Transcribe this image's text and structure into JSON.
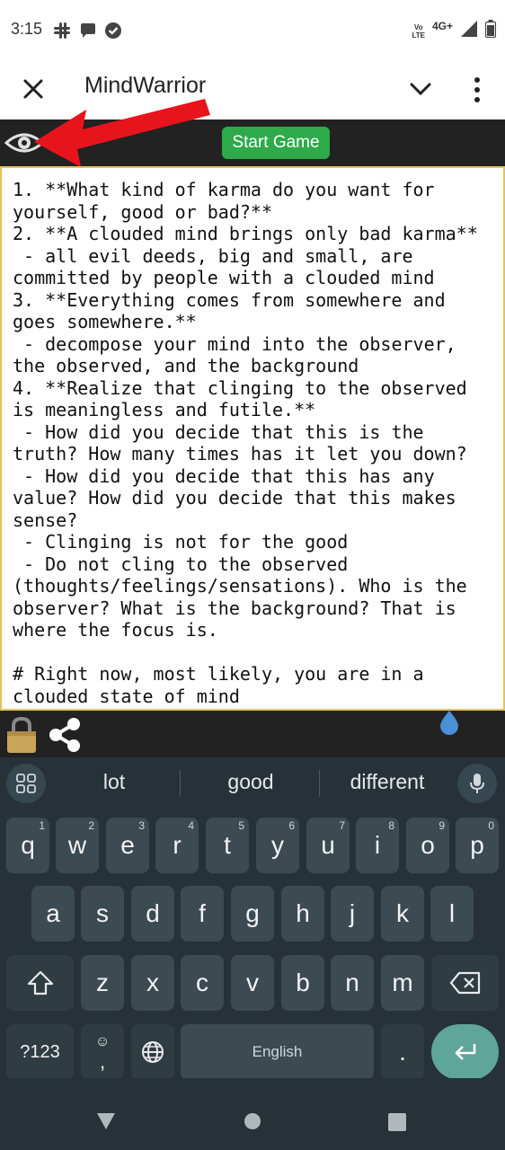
{
  "status": {
    "time": "3:15",
    "volte_line1": "Vo",
    "volte_line2": "LTE",
    "network": "4G+"
  },
  "app_bar": {
    "title": "MindWarrior"
  },
  "toolbar": {
    "start_label": "Start Game"
  },
  "editor": {
    "content": "1. **What kind of karma do you want for yourself, good or bad?**\n2. **A clouded mind brings only bad karma**\n - all evil deeds, big and small, are committed by people with a clouded mind\n3. **Everything comes from somewhere and goes somewhere.**\n - decompose your mind into the observer, the observed, and the background\n4. **Realize that clinging to the observed is meaningless and futile.**\n - How did you decide that this is the truth? How many times has it let you down?\n - How did you decide that this has any value? How did you decide that this makes sense?\n - Clinging is not for the good\n - Do not cling to the observed (thoughts/feelings/sensations). Who is the observer? What is the background? That is where the focus is.\n\n# Right now, most likely, you are in a clouded state of mind"
  },
  "keyboard": {
    "suggestions": [
      "lot",
      "good",
      "different"
    ],
    "row1": [
      {
        "key": "q",
        "hint": "1"
      },
      {
        "key": "w",
        "hint": "2"
      },
      {
        "key": "e",
        "hint": "3"
      },
      {
        "key": "r",
        "hint": "4"
      },
      {
        "key": "t",
        "hint": "5"
      },
      {
        "key": "y",
        "hint": "6"
      },
      {
        "key": "u",
        "hint": "7"
      },
      {
        "key": "i",
        "hint": "8"
      },
      {
        "key": "o",
        "hint": "9"
      },
      {
        "key": "p",
        "hint": "0"
      }
    ],
    "row2": [
      "a",
      "s",
      "d",
      "f",
      "g",
      "h",
      "j",
      "k",
      "l"
    ],
    "row3": [
      "z",
      "x",
      "c",
      "v",
      "b",
      "n",
      "m"
    ],
    "symbols_label": "?123",
    "comma_label": ",",
    "emoji_hint": "☺",
    "space_label": "English",
    "period_label": "."
  },
  "colors": {
    "toolbar_bg": "#222222",
    "start_button": "#2eaa4a",
    "editor_border": "#e6c15a",
    "arrow": "#e8141c",
    "keyboard_bg": "#263238",
    "enter_key": "#5fa59a"
  },
  "icons": {
    "status": [
      "slack-icon",
      "chat-bubble-icon",
      "check-circle-icon",
      "signal-icon",
      "battery-icon"
    ],
    "app_bar": [
      "close-icon",
      "chevron-down-icon",
      "more-vert-icon"
    ],
    "toolbar": [
      "eye-icon"
    ],
    "bottom_bar": [
      "lock-icon",
      "share-icon",
      "water-drop-icon"
    ]
  }
}
